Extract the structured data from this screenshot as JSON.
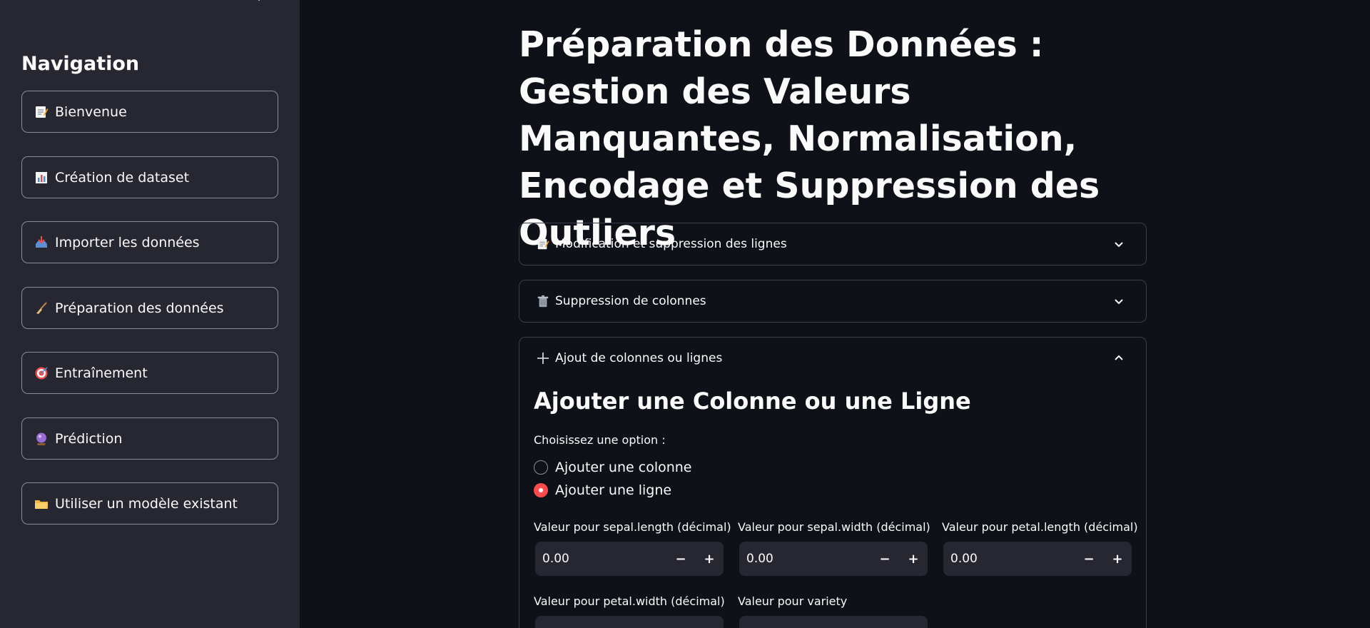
{
  "sidebar": {
    "title": "Navigation",
    "items": [
      {
        "label": "Bienvenue",
        "icon": "memo-icon"
      },
      {
        "label": "Création de dataset",
        "icon": "bar-chart-icon"
      },
      {
        "label": "Importer les données",
        "icon": "inbox-tray-icon"
      },
      {
        "label": "Préparation des données",
        "icon": "broom-icon"
      },
      {
        "label": "Entraînement",
        "icon": "target-icon"
      },
      {
        "label": "Prédiction",
        "icon": "crystal-ball-icon"
      },
      {
        "label": "Utiliser un modèle existant",
        "icon": "folder-icon"
      }
    ]
  },
  "main": {
    "title": "Préparation des Données : Gestion des Valeurs Manquantes, Normalisation, Encodage et Suppression des Outliers",
    "expanders": [
      {
        "label": "Modification et suppression des lignes",
        "icon": "memo-icon",
        "expanded": false
      },
      {
        "label": "Suppression de colonnes",
        "icon": "wastebasket-icon",
        "expanded": false
      },
      {
        "label": "Ajout de colonnes ou lignes",
        "icon": "plus-icon",
        "expanded": true
      }
    ],
    "add_section": {
      "title": "Ajouter une Colonne ou une Ligne",
      "choose_label": "Choisissez une option :",
      "options": [
        {
          "label": "Ajouter une colonne",
          "selected": false
        },
        {
          "label": "Ajouter une ligne",
          "selected": true
        }
      ],
      "fields": [
        {
          "label": "Valeur pour sepal.length (décimal)",
          "value": "0.00"
        },
        {
          "label": "Valeur pour sepal.width (décimal)",
          "value": "0.00"
        },
        {
          "label": "Valeur pour petal.length (décimal)",
          "value": "0.00"
        },
        {
          "label": "Valeur pour petal.width (décimal)",
          "value": ""
        },
        {
          "label": "Valeur pour variety",
          "value": ""
        }
      ],
      "stepper_minus": "−",
      "stepper_plus": "+"
    }
  },
  "colors": {
    "background": "#0e1117",
    "sidebar": "#262730",
    "accent": "#ff4b4b",
    "border": "#3b3d48"
  }
}
